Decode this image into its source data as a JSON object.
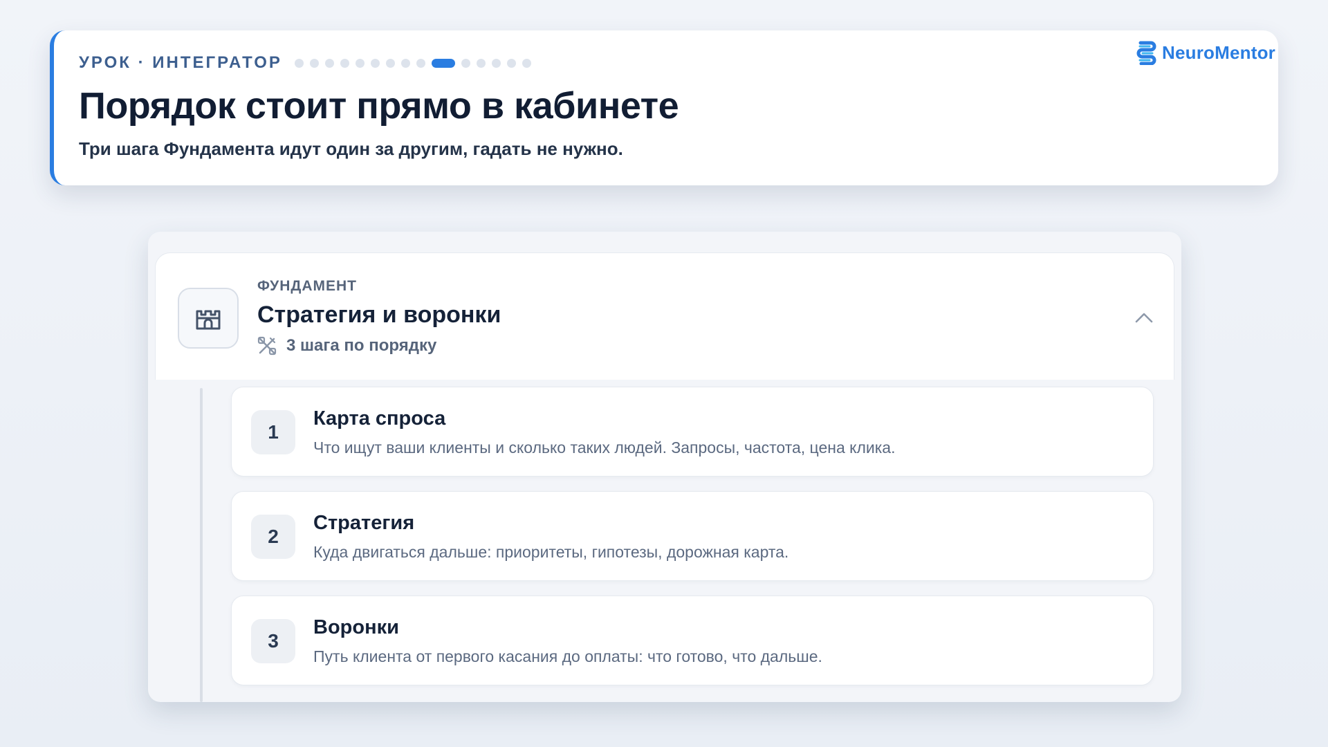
{
  "header": {
    "kicker": "УРОК · ИНТЕГРАТОР",
    "progress": {
      "total": 15,
      "current": 10
    },
    "title": "Порядок стоит прямо в кабинете",
    "subtitle": "Три шага Фундамента идут один за другим, гадать не нужно."
  },
  "brand": {
    "name": "NeuroMentor",
    "icon": "neuromentor-logo"
  },
  "colors": {
    "accent": "#2a7de1",
    "title": "#111d33",
    "muted": "#56647a",
    "dot_inactive": "#dde3ec"
  },
  "section": {
    "icon": "castle-icon",
    "kicker": "ФУНДАМЕНТ",
    "title": "Стратегия и воронки",
    "meta_icon": "tools-icon",
    "meta": "3 шага по порядку",
    "toggle_icon": "chevron-up-icon"
  },
  "steps": [
    {
      "number": "1",
      "title": "Карта спроса",
      "description": "Что ищут ваши клиенты и сколько таких людей. Запросы, частота, цена клика."
    },
    {
      "number": "2",
      "title": "Стратегия",
      "description": "Куда двигаться дальше: приоритеты, гипотезы, дорожная карта."
    },
    {
      "number": "3",
      "title": "Воронки",
      "description": "Путь клиента от первого касания до оплаты: что готово, что дальше."
    }
  ]
}
